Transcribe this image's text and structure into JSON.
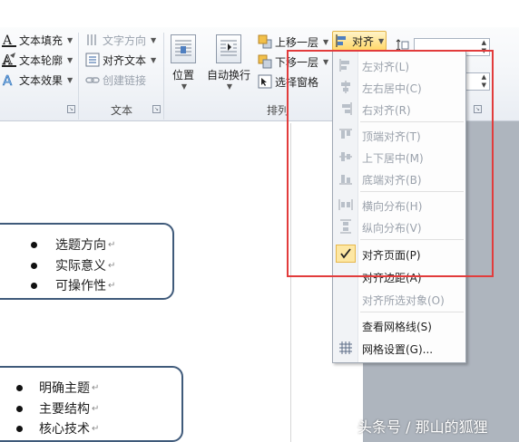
{
  "ribbon": {
    "text_group": {
      "label": "文本",
      "items": {
        "text_fill": "文本填充",
        "text_outline": "文本轮廓",
        "text_effects": "文本效果",
        "text_direction": "文字方向",
        "align_text": "对齐文本",
        "create_link": "创建链接"
      }
    },
    "arrange_group": {
      "label": "排列",
      "position": "位置",
      "wrap_text": "自动换行",
      "bring_forward": "上移一层",
      "send_backward": "下移一层",
      "selection_pane": "选择窗格",
      "align": "对齐"
    }
  },
  "menu": {
    "items": [
      {
        "label": "左对齐(L)",
        "icon": "align-left-icon",
        "enabled": false
      },
      {
        "label": "左右居中(C)",
        "icon": "align-center-icon",
        "enabled": false
      },
      {
        "label": "右对齐(R)",
        "icon": "align-right-icon",
        "enabled": false
      },
      {
        "label": "顶端对齐(T)",
        "icon": "align-top-icon",
        "enabled": false
      },
      {
        "label": "上下居中(M)",
        "icon": "align-middle-icon",
        "enabled": false
      },
      {
        "label": "底端对齐(B)",
        "icon": "align-bottom-icon",
        "enabled": false
      },
      {
        "label": "横向分布(H)",
        "icon": "distribute-horizontal-icon",
        "enabled": false
      },
      {
        "label": "纵向分布(V)",
        "icon": "distribute-vertical-icon",
        "enabled": false
      },
      {
        "label": "对齐页面(P)",
        "icon": "check-icon",
        "enabled": true,
        "checked": true
      },
      {
        "label": "对齐边距(A)",
        "icon": "",
        "enabled": true
      },
      {
        "label": "对齐所选对象(O)",
        "icon": "",
        "enabled": false
      },
      {
        "label": "查看网格线(S)",
        "icon": "",
        "enabled": true
      },
      {
        "label": "网格设置(G)...",
        "icon": "grid-icon",
        "enabled": true
      }
    ]
  },
  "document": {
    "box1": [
      "选题方向",
      "实际意义",
      "可操作性"
    ],
    "box2": [
      "明确主题",
      "主要结构",
      "核心技术"
    ],
    "paragraph_mark": "↵"
  },
  "watermark": "头条号 / 那山的狐狸",
  "colors": {
    "highlight": "#e23c3c",
    "textbox_border": "#3f5a7a",
    "active_button": "#ffd86a"
  }
}
